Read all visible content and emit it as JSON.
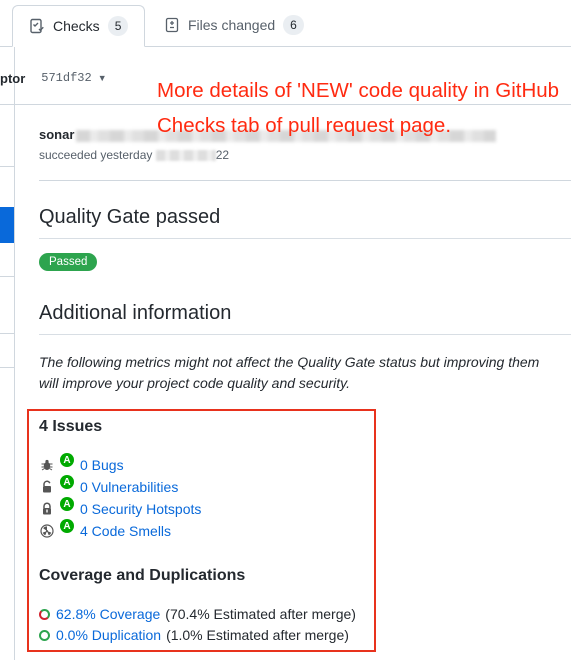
{
  "tabs": [
    {
      "label": "Checks",
      "count": "5",
      "active": true
    },
    {
      "label": "Files changed",
      "count": "6",
      "active": false
    }
  ],
  "commit": {
    "name": "ptor",
    "sha": "571df32"
  },
  "check_run": {
    "name": "sonar",
    "status": "succeeded yesterday",
    "status_tail": "22"
  },
  "quality_gate": {
    "title": "Quality Gate passed",
    "badge": "Passed"
  },
  "additional": {
    "title": "Additional information",
    "description": "The following metrics might not affect the Quality Gate status but improving them will improve your project code quality and security."
  },
  "issues": {
    "title": "4 Issues",
    "items": [
      {
        "icon": "bug-icon",
        "grade": "A",
        "label": "0 Bugs"
      },
      {
        "icon": "lock-open-icon",
        "grade": "A",
        "label": "0 Vulnerabilities"
      },
      {
        "icon": "hotspot-lock-icon",
        "grade": "A",
        "label": "0 Security Hotspots"
      },
      {
        "icon": "code-smell-icon",
        "grade": "A",
        "label": "4 Code Smells"
      }
    ]
  },
  "coverage": {
    "title": "Coverage and Duplications",
    "items": [
      {
        "label": "62.8% Coverage",
        "note": "(70.4% Estimated after merge)"
      },
      {
        "label": "0.0% Duplication",
        "note": "(1.0% Estimated after merge)"
      }
    ]
  },
  "annotation": "More details of 'NEW' code quality in GitHub Checks tab of pull request page.",
  "colors": {
    "accent_link": "#0969da",
    "passed_green": "#2da44e",
    "grade_green": "#00aa00",
    "annotation_red": "#ff2a10"
  }
}
